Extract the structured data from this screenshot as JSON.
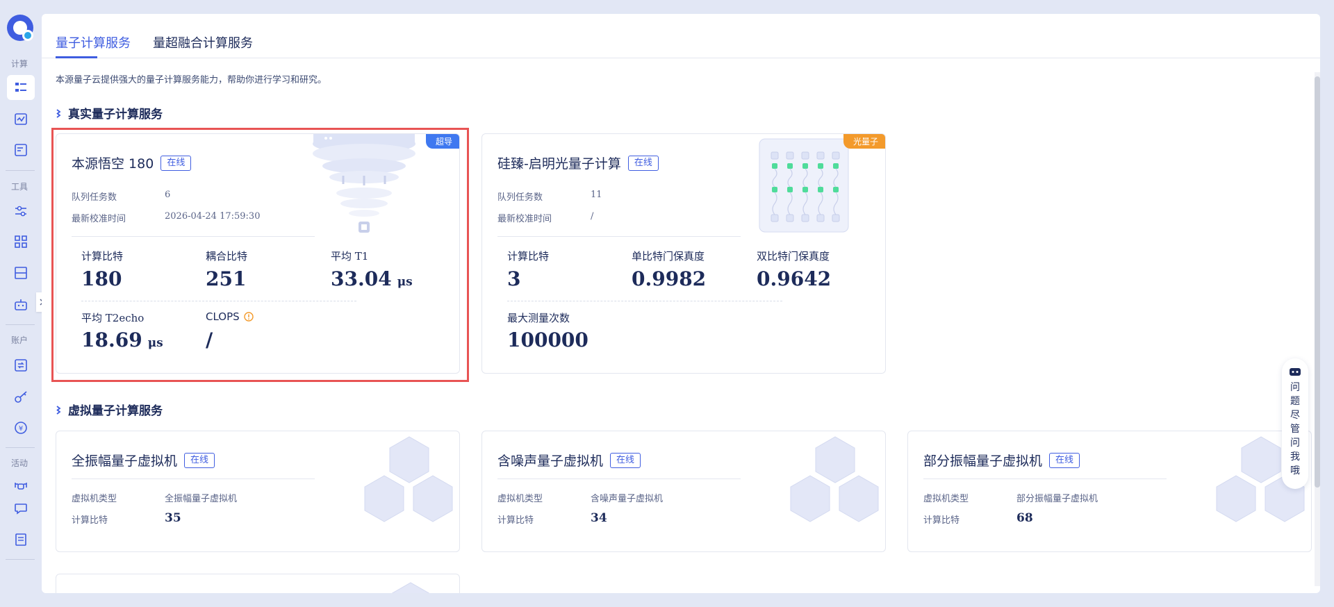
{
  "sidebar": {
    "categories": {
      "compute": "计算",
      "tools": "工具",
      "account": "账户",
      "activity": "活动"
    },
    "icons": [
      "task-list-icon",
      "monitor-chart-icon",
      "document-icon",
      "sliders-icon",
      "apps-grid-icon",
      "server-icon",
      "robot-icon",
      "exchange-icon",
      "key-icon",
      "yen-icon",
      "drone-icon",
      "chat-icon",
      "notes-icon"
    ]
  },
  "tabs": [
    {
      "label": "量子计算服务",
      "active": true
    },
    {
      "label": "量超融合计算服务",
      "active": false
    }
  ],
  "intro": "本源量子云提供强大的量子计算服务能力，帮助你进行学习和研究。",
  "sections": {
    "real": "真实量子计算服务",
    "virtual": "虚拟量子计算服务"
  },
  "real_cards": [
    {
      "name": "本源悟空 180",
      "status": "在线",
      "tag": "超导",
      "queue_label": "队列任务数",
      "queue_value": "6",
      "calib_label": "最新校准时间",
      "calib_value": "2026-04-24 17:59:30",
      "stats": [
        {
          "label": "计算比特",
          "value": "180",
          "unit": ""
        },
        {
          "label": "耦合比特",
          "value": "251",
          "unit": ""
        },
        {
          "label": "平均 T1",
          "value": "33.04",
          "unit": "μs"
        },
        {
          "label": "平均 T2echo",
          "value": "18.69",
          "unit": "μs"
        },
        {
          "label": "CLOPS",
          "value": "/",
          "unit": ""
        }
      ]
    },
    {
      "name": "硅臻-启明光量子计算",
      "status": "在线",
      "tag": "光量子",
      "queue_label": "队列任务数",
      "queue_value": "11",
      "calib_label": "最新校准时间",
      "calib_value": "/",
      "stats": [
        {
          "label": "计算比特",
          "value": "3"
        },
        {
          "label": "单比特门保真度",
          "value": "0.9982"
        },
        {
          "label": "双比特门保真度",
          "value": "0.9642"
        },
        {
          "label": "最大测量次数",
          "value": "100000"
        }
      ]
    }
  ],
  "virtual_cards": [
    {
      "name": "全振幅量子虚拟机",
      "status": "在线",
      "type_label": "虚拟机类型",
      "type_value": "全振幅量子虚拟机",
      "bits_label": "计算比特",
      "bits_value": "35"
    },
    {
      "name": "含噪声量子虚拟机",
      "status": "在线",
      "type_label": "虚拟机类型",
      "type_value": "含噪声量子虚拟机",
      "bits_label": "计算比特",
      "bits_value": "34"
    },
    {
      "name": "部分振幅量子虚拟机",
      "status": "在线",
      "type_label": "虚拟机类型",
      "type_value": "部分振幅量子虚拟机",
      "bits_label": "计算比特",
      "bits_value": "68"
    }
  ],
  "assistant": {
    "text": "问题尽管问我哦"
  },
  "colors": {
    "accent": "#3f5de0",
    "superconduct_tag": "#3f78f0",
    "photonic_tag": "#f39a2b",
    "highlight": "#e85454"
  }
}
